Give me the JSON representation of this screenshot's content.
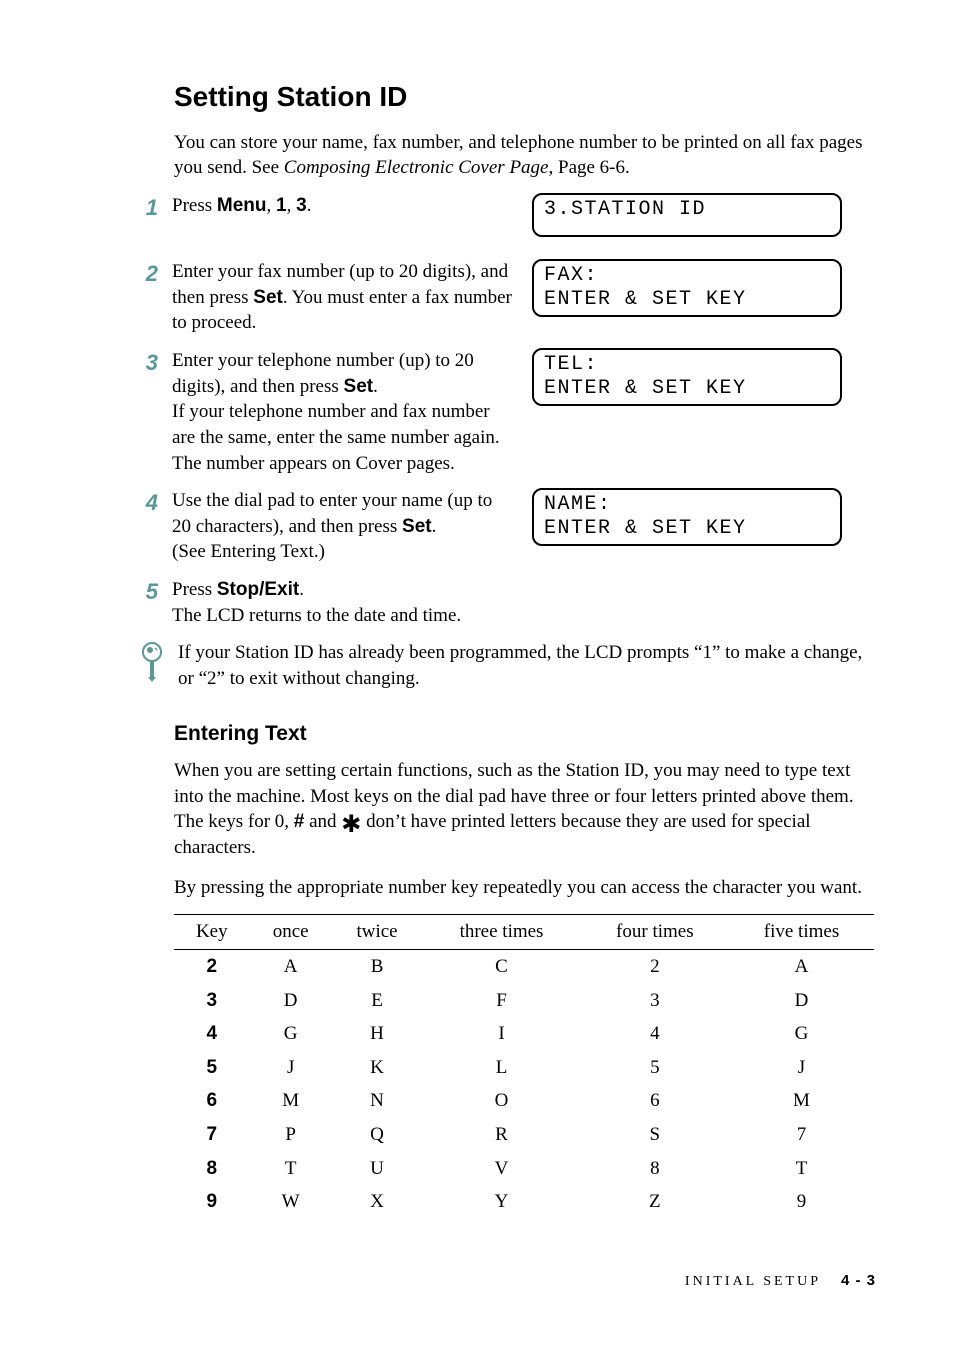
{
  "heading": "Setting Station ID",
  "intro_prefix": "You can store your name, fax number, and telephone number to be printed on all fax pages you send. See ",
  "intro_italic": "Composing Electronic Cover Page",
  "intro_suffix": ", Page 6-6.",
  "steps": [
    {
      "num": "1",
      "parts": [
        {
          "t": "Press "
        },
        {
          "t": "Menu",
          "b": true
        },
        {
          "t": ", "
        },
        {
          "t": "1",
          "b": true
        },
        {
          "t": ", "
        },
        {
          "t": "3",
          "b": true
        },
        {
          "t": "."
        }
      ],
      "lcd": [
        "3.STATION ID"
      ]
    },
    {
      "num": "2",
      "parts": [
        {
          "t": "Enter your fax number (up to 20 digits), and then press "
        },
        {
          "t": "Set",
          "b": true
        },
        {
          "t": ". You must enter a fax number to proceed."
        }
      ],
      "lcd": [
        "FAX:\nENTER & SET KEY"
      ]
    },
    {
      "num": "3",
      "parts": [
        {
          "t": "Enter your telephone number (up) to 20 digits), and then press "
        },
        {
          "t": "Set",
          "b": true
        },
        {
          "t": "."
        },
        {
          "br": true
        },
        {
          "t": "If your telephone number and fax number are the same, enter the same number again. The number appears on Cover pages."
        }
      ],
      "lcd": [
        "TEL:\nENTER & SET KEY"
      ]
    },
    {
      "num": "4",
      "parts": [
        {
          "t": "Use the dial pad to enter your name (up to 20 characters), and then press "
        },
        {
          "t": "Set",
          "b": true
        },
        {
          "t": "."
        },
        {
          "br": true
        },
        {
          "t": "(See Entering Text.)"
        }
      ],
      "lcd": [
        "NAME:\nENTER & SET KEY"
      ]
    },
    {
      "num": "5",
      "parts": [
        {
          "t": "Press "
        },
        {
          "t": "Stop/Exit",
          "b": true
        },
        {
          "t": "."
        },
        {
          "br": true
        },
        {
          "t": "The LCD returns to the date and time."
        }
      ]
    }
  ],
  "note": "If your Station ID has already been programmed, the LCD prompts “1” to make a change, or “2” to exit without changing.",
  "subheading": "Entering Text",
  "entering_p1_a": "When you are setting certain functions, such as the Station ID, you may need to type text into the machine. Most keys on the dial pad have three or four letters printed above them. The keys for 0, ",
  "entering_p1_hash": "#",
  "entering_p1_b": " and  ",
  "entering_p1_c": "  don’t have printed letters because they are used for special characters.",
  "entering_p2": "By pressing the appropriate number key repeatedly you can access the character you want.",
  "table": {
    "headers": [
      "Key",
      "once",
      "twice",
      "three times",
      "four times",
      "five times"
    ],
    "rows": [
      [
        "2",
        "A",
        "B",
        "C",
        "2",
        "A"
      ],
      [
        "3",
        "D",
        "E",
        "F",
        "3",
        "D"
      ],
      [
        "4",
        "G",
        "H",
        "I",
        "4",
        "G"
      ],
      [
        "5",
        "J",
        "K",
        "L",
        "5",
        "J"
      ],
      [
        "6",
        "M",
        "N",
        "O",
        "6",
        "M"
      ],
      [
        "7",
        "P",
        "Q",
        "R",
        "S",
        "7"
      ],
      [
        "8",
        "T",
        "U",
        "V",
        "8",
        "T"
      ],
      [
        "9",
        "W",
        "X",
        "Y",
        "Z",
        "9"
      ]
    ]
  },
  "footer_section": "INITIAL SETUP",
  "footer_page": "4 - 3"
}
